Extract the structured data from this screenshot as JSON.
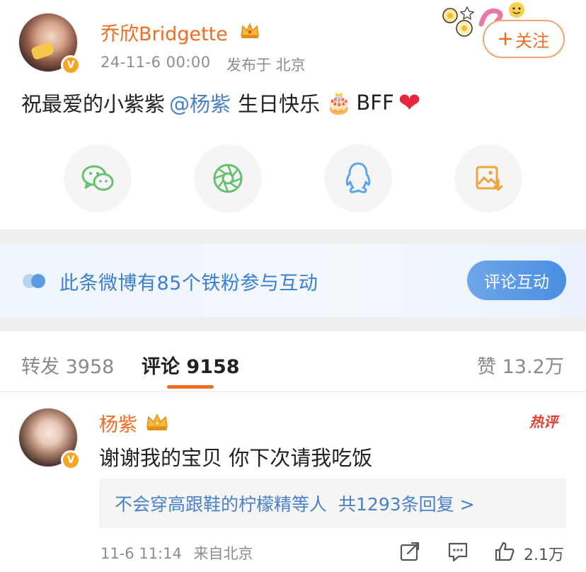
{
  "post": {
    "author": "乔欣Bridgette",
    "time": "24-11-6 00:00",
    "location": "发布于 北京",
    "follow_label": "关注",
    "follow_icon": "plus-icon",
    "text_before": "祝最爱的小紫紫",
    "mention": "@杨紫",
    "text_after": "生日快乐",
    "text_suffix": "BFF",
    "emoji_cake": "🎂",
    "emoji_heart": "❤"
  },
  "share": [
    {
      "name": "wechat-share",
      "icon": "wechat-icon",
      "color": "#66c06f"
    },
    {
      "name": "moments-share",
      "icon": "moments-icon",
      "color": "#66c06f"
    },
    {
      "name": "qq-share",
      "icon": "qq-icon",
      "color": "#59a7ea"
    },
    {
      "name": "save-image",
      "icon": "save-image-icon",
      "color": "#f1a43b"
    }
  ],
  "fans_banner": {
    "text": "此条微博有85个铁粉参与互动",
    "button_label": "评论互动"
  },
  "tabs": {
    "repost": "转发 3958",
    "comment_label": "评论",
    "comment_count": "9158",
    "like": "赞 13.2万"
  },
  "comment": {
    "author": "杨紫",
    "hot_tag": "热评",
    "text": "谢谢我的宝贝 你下次请我吃饭",
    "reply_names": "不会穿高跟鞋的柠檬精等人",
    "reply_count": "共1293条回复 >",
    "time": "11-6 11:14",
    "source": "来自北京",
    "like_count": "2.1万"
  },
  "colors": {
    "accent_orange": "#f06d22",
    "link_blue": "#4a80c6",
    "banner_blue": "#3b7fd1",
    "heart_red": "#e8253b"
  }
}
